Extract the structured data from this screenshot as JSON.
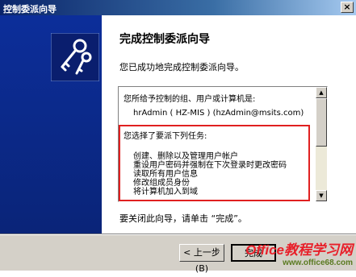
{
  "window": {
    "title": "控制委派向导"
  },
  "main": {
    "heading": "完成控制委派向导",
    "intro": "您已成功地完成控制委派向导。",
    "summary": {
      "line1": "您所给予控制的组、用户或计算机是:",
      "line2": "hrAdmin ( HZ-MIS ) (hzAdmin@msits.com)",
      "line3": "您选择了要派下列任务:",
      "tasks": [
        "创建、删除以及管理用户帐户",
        "重设用户密码并强制在下次登录时更改密码",
        "读取所有用户信息",
        "修改组成员身份",
        "将计算机加入到域"
      ]
    },
    "closing": "要关闭此向导，请单击 “完成”。"
  },
  "footer": {
    "back_label": "< 上一步(B)",
    "finish_label": "完成"
  },
  "watermark": {
    "line1": "Office教程学习网",
    "line2": "www.office68.com"
  }
}
